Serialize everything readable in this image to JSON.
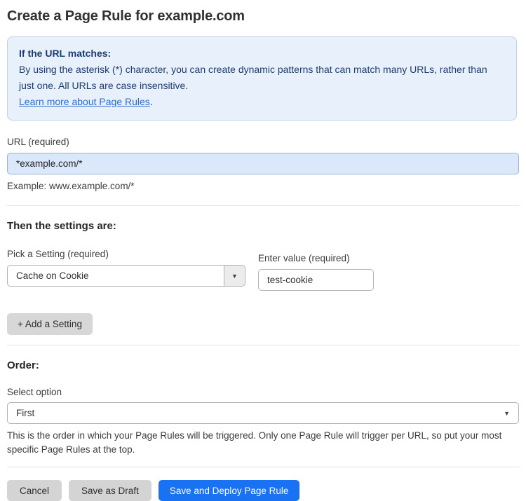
{
  "header": {
    "title": "Create a Page Rule for example.com"
  },
  "info_box": {
    "heading": "If the URL matches:",
    "body": "By using the asterisk (*) character, you can create dynamic patterns that can match many URLs, rather than just one. All URLs are case insensitive.",
    "link_label": "Learn more about Page Rules",
    "link_suffix": "."
  },
  "url": {
    "label": "URL (required)",
    "value": "*example.com/*",
    "helper": "Example: www.example.com/*"
  },
  "settings": {
    "heading": "Then the settings are:",
    "pick_label": "Pick a Setting (required)",
    "pick_value": "Cache on Cookie",
    "value_label": "Enter value (required)",
    "value_text": "test-cookie",
    "add_button": "+ Add a Setting"
  },
  "order": {
    "heading": "Order:",
    "select_label": "Select option",
    "select_value": "First",
    "helper": "This is the order in which your Page Rules will be triggered. Only one Page Rule will trigger per URL, so put your most specific Page Rules at the top."
  },
  "footer": {
    "cancel": "Cancel",
    "save_draft": "Save as Draft",
    "save_deploy": "Save and Deploy Page Rule"
  },
  "icons": {
    "dropdown_arrow": "▼"
  },
  "colors": {
    "accent_blue": "#1972f2",
    "info_background": "#e8f1fb",
    "info_border": "#b9d3ee",
    "info_text": "#1d3d6e",
    "link_blue": "#2c6bcf",
    "url_input_background": "#dbe7fa",
    "button_gray": "#d4d4d4",
    "divider_gray": "#e3e3e3"
  }
}
